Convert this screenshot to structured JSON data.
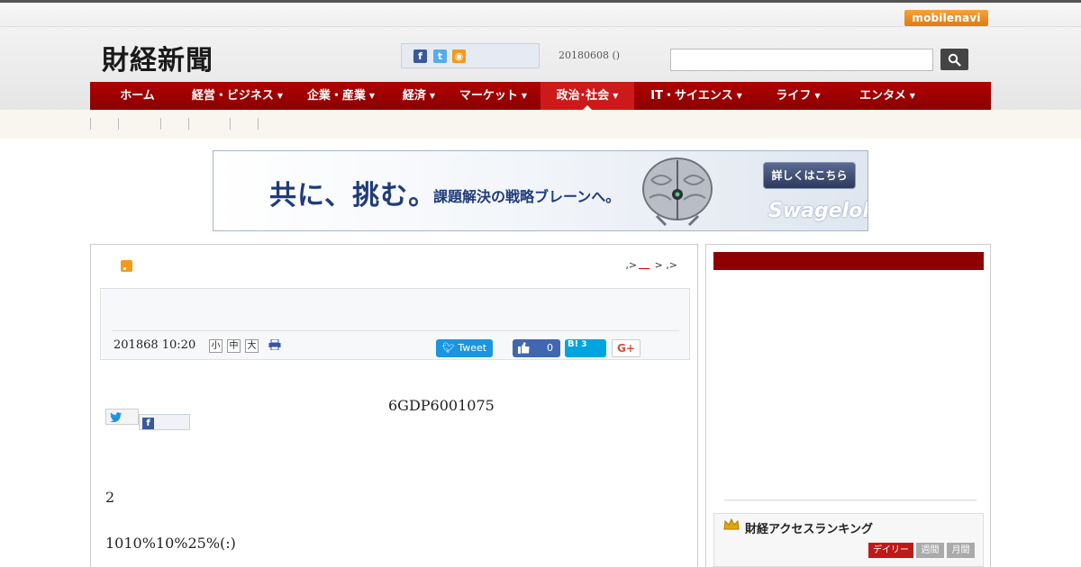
{
  "topbar": {
    "mobile_navi_label": "mobilenavi"
  },
  "header": {
    "logo": "財経新聞",
    "date": "20180608 ()",
    "search": {
      "value": "",
      "button_icon": "search-icon"
    },
    "social_icons": [
      "facebook-icon",
      "twitter-icon",
      "rss-icon"
    ]
  },
  "nav": {
    "items": [
      {
        "label": "ホーム",
        "arrow": false
      },
      {
        "label": "経営・ビジネス",
        "arrow": true
      },
      {
        "label": "企業・産業",
        "arrow": true
      },
      {
        "label": "経済",
        "arrow": true
      },
      {
        "label": "マーケット",
        "arrow": true
      },
      {
        "label": "政治･社会",
        "arrow": true,
        "active": true
      },
      {
        "label": "IT・サイエンス",
        "arrow": true
      },
      {
        "label": "ライフ",
        "arrow": true
      },
      {
        "label": "エンタメ",
        "arrow": true
      }
    ],
    "arrow_glyph": "▼"
  },
  "banner": {
    "main": "共に、挑む。",
    "sub": "課題解決の戦略ブレーンへ。",
    "cta": "詳しくはこちら",
    "brand": "Swagelok"
  },
  "article": {
    "breadcrumb": {
      "a": ",>",
      "b": ">",
      "c": ",>"
    },
    "date": "201868 10:20",
    "font_sizes": [
      "小",
      "中",
      "大"
    ],
    "tweet_label": "Tweet",
    "like_count": "0",
    "hatena_label": "B!",
    "hatena_count": "3",
    "gplus_label": "G+",
    "paragraphs": [
      "6GDP6001075",
      "2",
      "1010%10%25%(:)"
    ]
  },
  "sidebar": {
    "ranking_title": "財経アクセスランキング",
    "tabs": [
      "デイリー",
      "週間",
      "月間"
    ]
  },
  "colors": {
    "nav_red": "#a50000",
    "active_red": "#cc1a1a",
    "banner_blue": "#1f3c7a"
  }
}
